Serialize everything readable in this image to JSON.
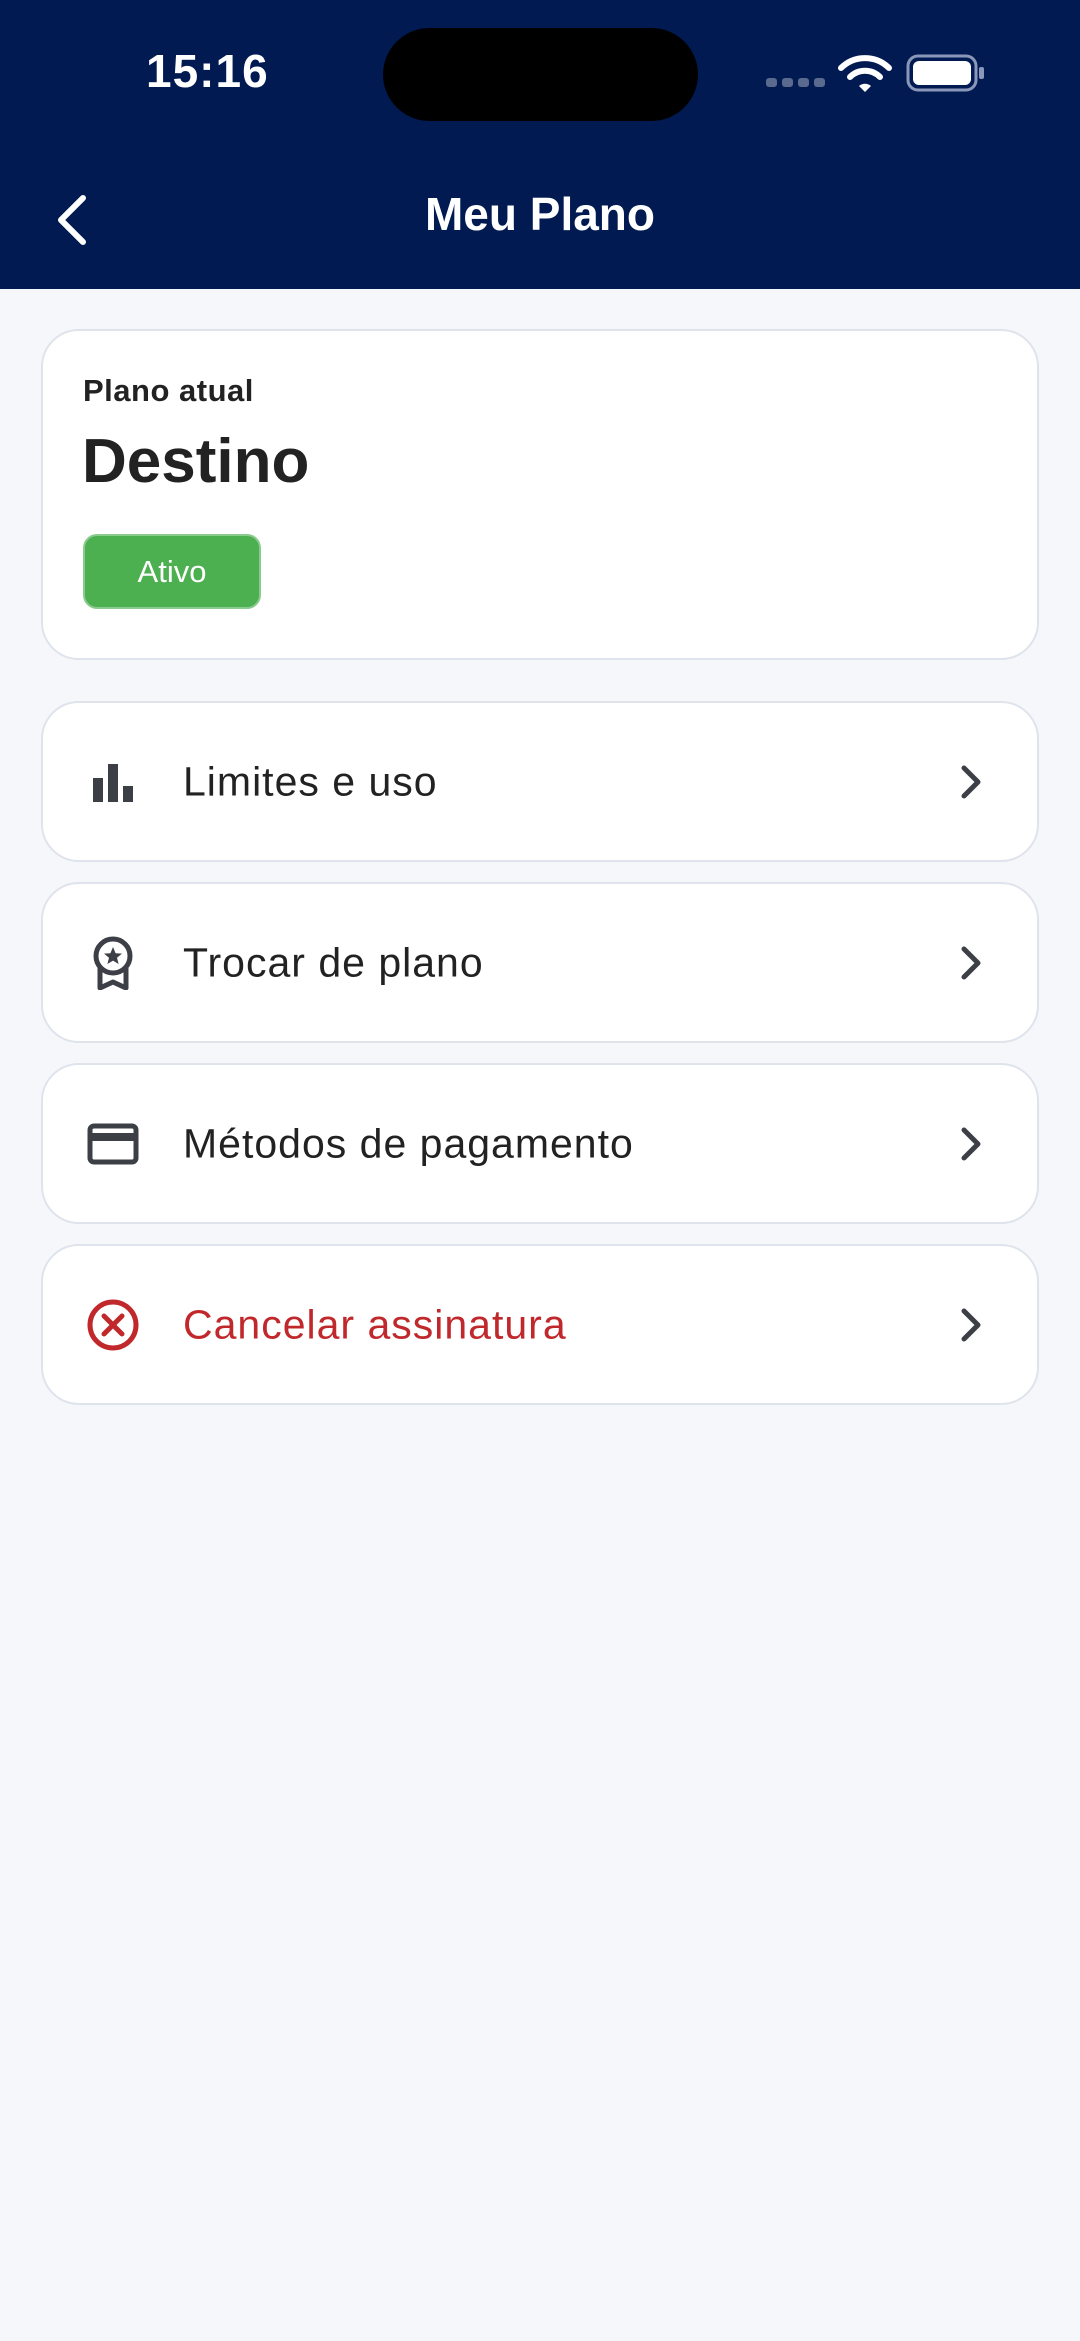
{
  "status_bar": {
    "time": "15:16"
  },
  "header": {
    "title": "Meu Plano",
    "back_icon": "chevron-left-icon",
    "background": "#011a52"
  },
  "plan": {
    "label": "Plano atual",
    "name": "Destino",
    "status": "Ativo",
    "status_color": "#4caf50"
  },
  "menu": [
    {
      "label": "Limites e uso",
      "icon": "bar-chart-icon"
    },
    {
      "label": "Trocar de plano",
      "icon": "award-badge-icon"
    },
    {
      "label": "Métodos de pagamento",
      "icon": "credit-card-icon"
    },
    {
      "label": "Cancelar assinatura",
      "icon": "cancel-circle-icon",
      "color": "#c0282b"
    }
  ]
}
